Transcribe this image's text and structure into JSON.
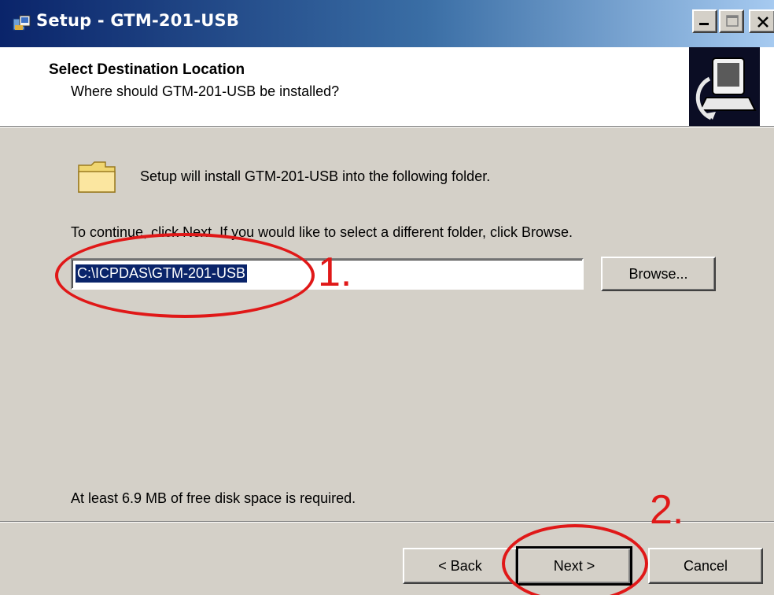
{
  "window": {
    "title": "Setup - GTM-201-USB",
    "icons": {
      "app": "setup-app-icon",
      "minimize": "minimize-icon",
      "maximize": "maximize-icon",
      "close": "close-icon"
    }
  },
  "header": {
    "title": "Select Destination Location",
    "subtitle": "Where should GTM-201-USB be installed?",
    "logo_icon": "computer-install-icon"
  },
  "body": {
    "folder_icon": "folder-icon",
    "intro_text": "Setup will install GTM-201-USB into the following folder.",
    "continue_text": "To continue, click Next. If you would like to select a different folder, click Browse.",
    "path_value": "C:\\ICPDAS\\GTM-201-USB",
    "browse_label": "Browse...",
    "space_text": "At least 6.9 MB of free disk space is required."
  },
  "footer": {
    "back_label": "< Back",
    "next_label": "Next >",
    "cancel_label": "Cancel"
  },
  "annotations": {
    "step1": "1.",
    "step2": "2.",
    "color": "#e01818"
  }
}
